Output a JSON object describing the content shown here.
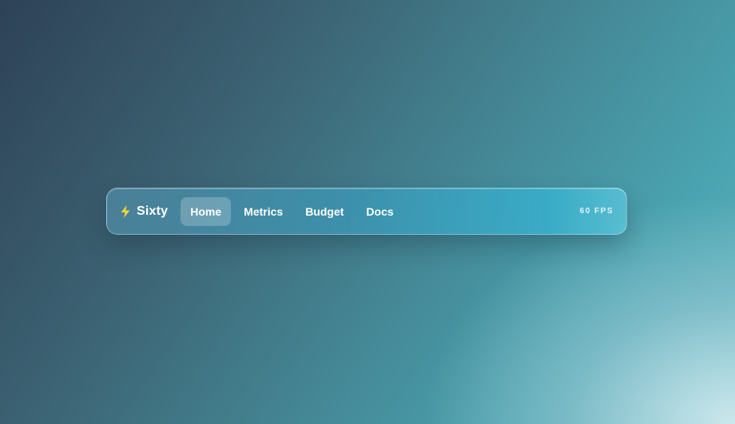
{
  "brand": {
    "name": "Sixty",
    "icon": "lightning-bolt-icon",
    "icon_color": "#f5d33a"
  },
  "nav": {
    "items": [
      {
        "label": "Home",
        "active": true
      },
      {
        "label": "Metrics",
        "active": false
      },
      {
        "label": "Budget",
        "active": false
      },
      {
        "label": "Docs",
        "active": false
      }
    ]
  },
  "status": {
    "fps": "60 FPS"
  }
}
